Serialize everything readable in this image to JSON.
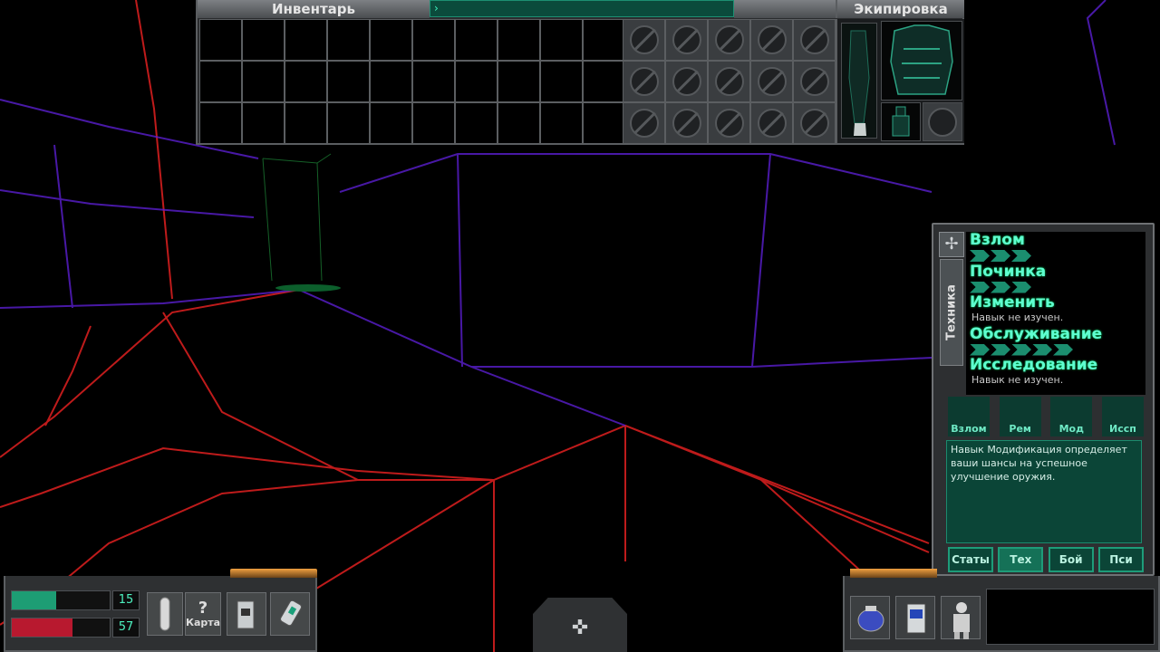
{
  "inventory": {
    "title": "Инвентарь",
    "search_value": "›",
    "equip_title": "Экипировка"
  },
  "skills": {
    "side_tab": "Техника",
    "pin_icon": "✢",
    "items": [
      {
        "name": "Взлом",
        "level": 3,
        "note": ""
      },
      {
        "name": "Починка",
        "level": 3,
        "note": ""
      },
      {
        "name": "Изменить",
        "level": 0,
        "note": "Навык не изучен."
      },
      {
        "name": "Обслуживание",
        "level": 5,
        "note": ""
      },
      {
        "name": "Исследование",
        "level": 0,
        "note": "Навык не изучен."
      }
    ],
    "buttons": [
      "Взлом",
      "Рем",
      "Мод",
      "Иссп"
    ],
    "description": "Навык Модификация определяет ваши шансы на успешное улучшение оружия.",
    "stat_tabs": [
      "Статы",
      "Тех",
      "Бой",
      "Пси"
    ],
    "active_stat_tab": "Тех"
  },
  "hud": {
    "health": 15,
    "psi": 57,
    "health_fraction": 0.45,
    "psi_fraction": 0.62,
    "map_label": "Карта",
    "map_icon": "?",
    "crosshair_icon": "✜",
    "accent": "#4df2c0"
  }
}
